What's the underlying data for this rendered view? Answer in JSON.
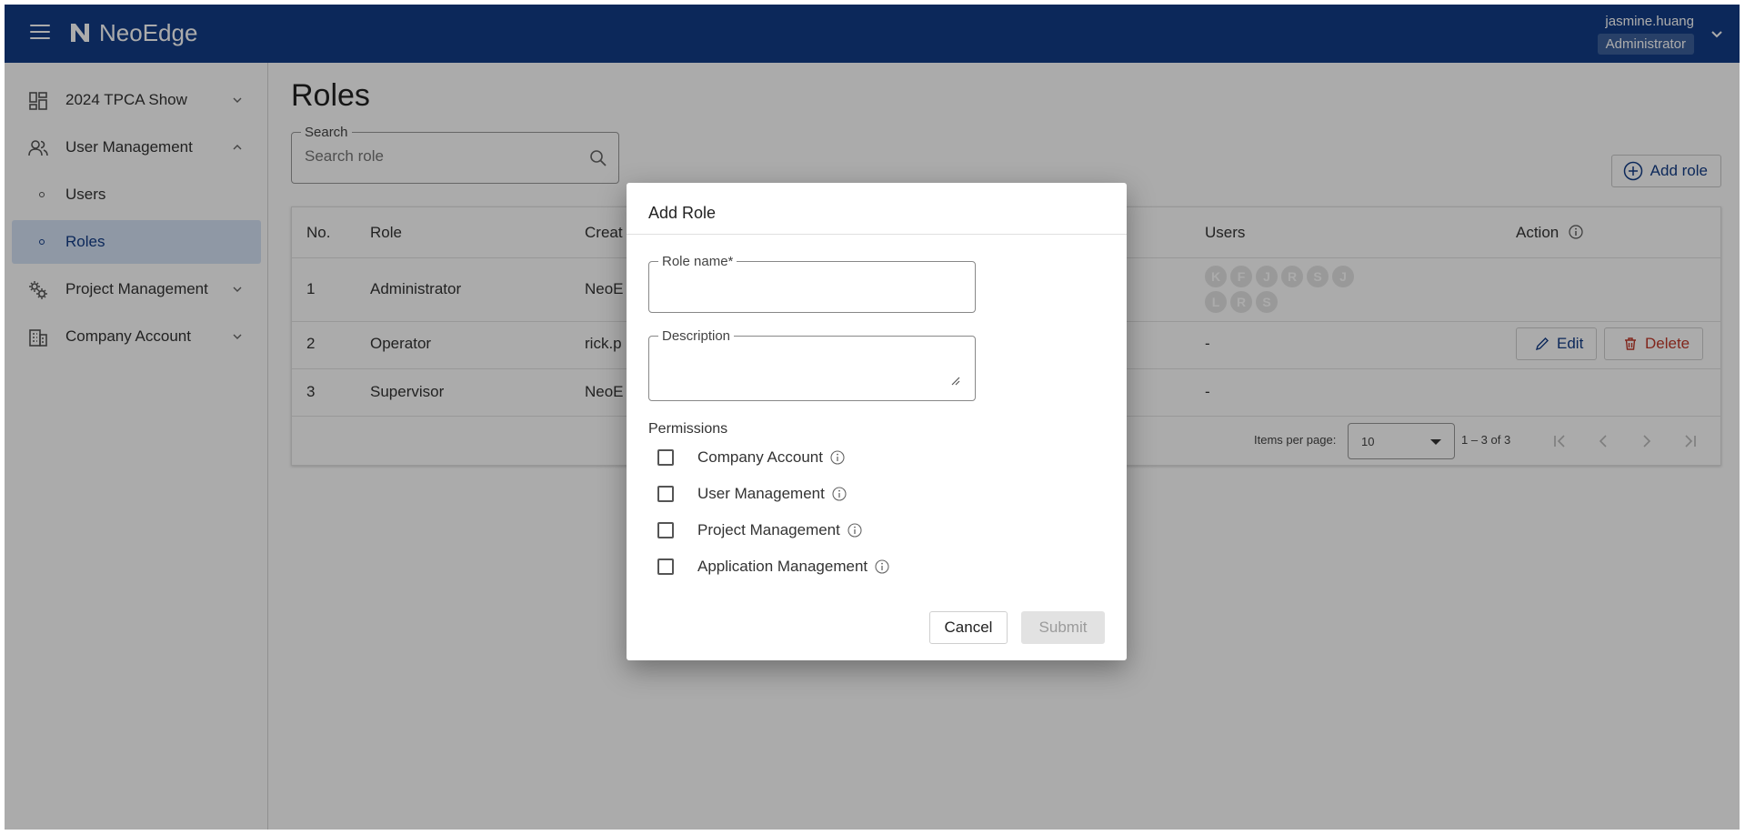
{
  "app": {
    "brand": "NeoEdge",
    "colors": {
      "header": "#133d87",
      "accent": "#133d87",
      "danger": "#c0392b",
      "active_bg": "#d6e3f7"
    }
  },
  "header": {
    "user_name": "jasmine.huang",
    "user_role": "Administrator"
  },
  "sidebar": {
    "items": [
      {
        "label": "2024 TPCA Show",
        "icon": "dashboard-icon"
      },
      {
        "label": "User Management",
        "icon": "users-icon"
      },
      {
        "label": "Users"
      },
      {
        "label": "Roles",
        "active": true
      },
      {
        "label": "Project Management",
        "icon": "gears-icon"
      },
      {
        "label": "Company Account",
        "icon": "building-icon"
      }
    ]
  },
  "main": {
    "title": "Roles",
    "search": {
      "legend": "Search",
      "placeholder": "Search role"
    },
    "add_role_label": "Add role",
    "table": {
      "headers": {
        "no": "No.",
        "role": "Role",
        "created": "Creat",
        "users": "Users",
        "action": "Action"
      },
      "rows": [
        {
          "no": "1",
          "role": "Administrator",
          "created": "NeoE",
          "users": [
            "K",
            "F",
            "J",
            "R",
            "S",
            "J",
            "L",
            "R",
            "S"
          ]
        },
        {
          "no": "2",
          "role": "Operator",
          "created": "rick.p",
          "users_text": "-",
          "edit": "Edit",
          "delete": "Delete"
        },
        {
          "no": "3",
          "role": "Supervisor",
          "created": "NeoE",
          "users_text": "-"
        }
      ]
    },
    "pager": {
      "items_per_page_label": "Items per page:",
      "items_per_page": "10",
      "range": "1 – 3 of 3"
    }
  },
  "dialog": {
    "title": "Add Role",
    "role_name_legend": "Role name*",
    "role_name_value": "",
    "description_legend": "Description",
    "description_value": "",
    "permissions_title": "Permissions",
    "permissions": [
      {
        "label": "Company Account",
        "checked": false
      },
      {
        "label": "User Management",
        "checked": false
      },
      {
        "label": "Project Management",
        "checked": false
      },
      {
        "label": "Application Management",
        "checked": false
      }
    ],
    "cancel_label": "Cancel",
    "submit_label": "Submit"
  }
}
